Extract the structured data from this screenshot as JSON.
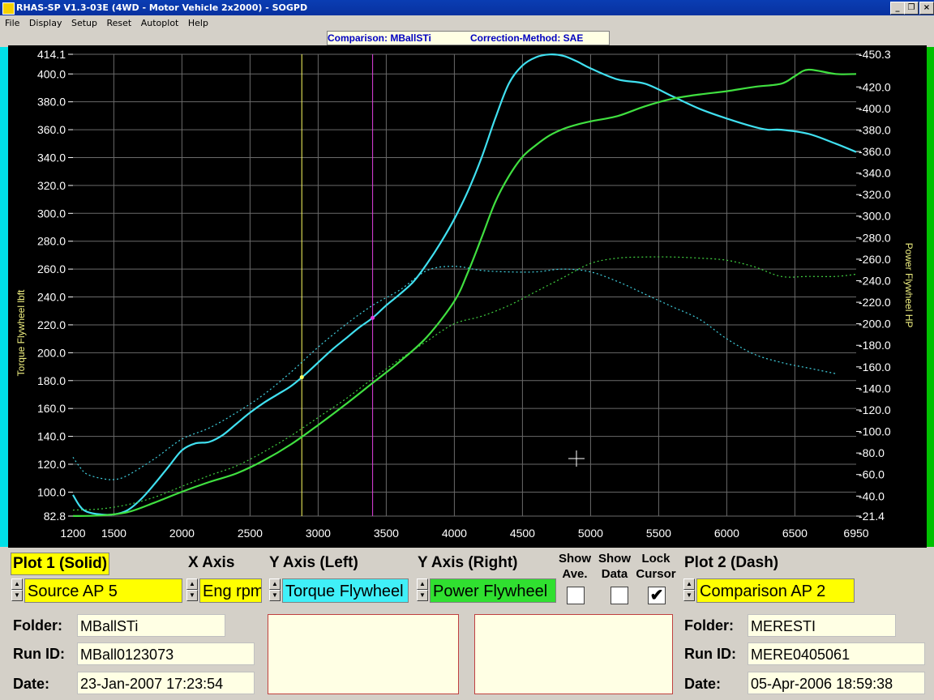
{
  "window": {
    "title": "RHAS-SP V1.3-03E  (4WD - Motor Vehicle 2x2000) - SOGPD",
    "minimize_glyph": "_",
    "restore_glyph": "❐",
    "close_glyph": "×"
  },
  "menu": [
    "File",
    "Display",
    "Setup",
    "Reset",
    "Autoplot",
    "Help"
  ],
  "status": {
    "comparison": "Comparison: MBallSTi",
    "correction": "Correction-Method: SAE"
  },
  "chart_data": {
    "type": "line",
    "xlim": [
      1200,
      6950
    ],
    "x_ticks": [
      "1200",
      "1500",
      "2000",
      "2500",
      "3000",
      "3500",
      "4000",
      "4500",
      "5000",
      "5500",
      "6000",
      "6500",
      "6950"
    ],
    "x_tick_values": [
      1200,
      1500,
      2000,
      2500,
      3000,
      3500,
      4000,
      4500,
      5000,
      5500,
      6000,
      6500,
      6950
    ],
    "ylim_left": [
      82.8,
      414.1
    ],
    "ylim_right": [
      21.4,
      450.3
    ],
    "y_left_ticks": [
      "82.8",
      "100.0",
      "120.0",
      "140.0",
      "160.0",
      "180.0",
      "200.0",
      "220.0",
      "240.0",
      "260.0",
      "280.0",
      "300.0",
      "320.0",
      "340.0",
      "360.0",
      "380.0",
      "400.0",
      "414.1"
    ],
    "y_left_tick_values": [
      82.8,
      100,
      120,
      140,
      160,
      180,
      200,
      220,
      240,
      260,
      280,
      300,
      320,
      340,
      360,
      380,
      400,
      414.1
    ],
    "y_right_ticks": [
      "21.4",
      "40.0",
      "60.0",
      "80.0",
      "100.0",
      "120.0",
      "140.0",
      "160.0",
      "180.0",
      "200.0",
      "220.0",
      "240.0",
      "260.0",
      "280.0",
      "300.0",
      "320.0",
      "340.0",
      "360.0",
      "380.0",
      "400.0",
      "420.0",
      "450.3"
    ],
    "y_right_tick_values": [
      21.4,
      40,
      60,
      80,
      100,
      120,
      140,
      160,
      180,
      200,
      220,
      240,
      260,
      280,
      300,
      320,
      340,
      360,
      380,
      400,
      420,
      450.3
    ],
    "ylabel_left": "Torque Flywheel lbft",
    "ylabel_right": "Power Flywheel HP",
    "grid": true,
    "cursors": [
      {
        "x": 2880,
        "color": "#ffff60"
      },
      {
        "x": 3400,
        "color": "#e040e0"
      }
    ],
    "series": [
      {
        "axis": "left",
        "style": "solid",
        "color": "#40e0f0",
        "x": [
          1200,
          1250,
          1300,
          1400,
          1500,
          1600,
          1700,
          1800,
          1900,
          2000,
          2100,
          2200,
          2300,
          2400,
          2500,
          2600,
          2700,
          2800,
          2900,
          3000,
          3100,
          3200,
          3300,
          3400,
          3500,
          3600,
          3700,
          3800,
          3900,
          4000,
          4100,
          4200,
          4300,
          4400,
          4500,
          4600,
          4700,
          4800,
          4900,
          5000,
          5200,
          5400,
          5600,
          5800,
          6000,
          6200,
          6300,
          6400,
          6600,
          6800,
          6950
        ],
        "y": [
          98,
          90,
          86,
          84,
          84,
          87,
          95,
          106,
          118,
          130,
          135,
          136,
          141,
          149,
          157,
          164,
          170,
          176,
          184,
          193,
          202,
          210,
          218,
          225,
          234,
          242,
          251,
          264,
          279,
          296,
          316,
          340,
          368,
          393,
          406,
          412,
          414,
          413,
          409,
          404,
          396,
          393,
          384,
          375,
          368,
          362,
          360,
          360,
          357,
          350,
          344
        ]
      },
      {
        "axis": "right",
        "style": "solid",
        "color": "#40e040",
        "x": [
          1200,
          1400,
          1600,
          1800,
          2000,
          2200,
          2400,
          2600,
          2800,
          3000,
          3200,
          3400,
          3600,
          3800,
          4000,
          4100,
          4200,
          4300,
          4400,
          4500,
          4600,
          4700,
          4800,
          4900,
          5000,
          5200,
          5400,
          5600,
          5800,
          6000,
          6200,
          6400,
          6500,
          6600,
          6800,
          6950
        ],
        "y": [
          21.5,
          22,
          25,
          34,
          44,
          53,
          61,
          73,
          88,
          106,
          125,
          145,
          165,
          188,
          221,
          248,
          280,
          313,
          337,
          355,
          366,
          375,
          381,
          385,
          388,
          393,
          402,
          409,
          413,
          416,
          420,
          423,
          430,
          436,
          432,
          432
        ]
      },
      {
        "axis": "left",
        "style": "dash",
        "color": "#40d0e0",
        "x": [
          1200,
          1250,
          1300,
          1400,
          1500,
          1600,
          1800,
          2000,
          2200,
          2400,
          2600,
          2800,
          3000,
          3200,
          3400,
          3600,
          3800,
          4000,
          4200,
          4400,
          4600,
          4800,
          5000,
          5200,
          5400,
          5600,
          5800,
          6000,
          6200,
          6400,
          6600,
          6800
        ],
        "y": [
          125,
          118,
          113,
          110,
          109,
          112,
          124,
          138,
          146,
          157,
          170,
          186,
          204,
          220,
          234,
          245,
          259,
          262,
          259,
          258,
          258,
          260,
          258,
          251,
          242,
          233,
          224,
          210,
          199,
          193,
          189,
          185
        ]
      },
      {
        "axis": "right",
        "style": "dash",
        "color": "#40d040",
        "x": [
          1200,
          1400,
          1600,
          1800,
          2000,
          2200,
          2400,
          2600,
          2800,
          3000,
          3200,
          3400,
          3600,
          3800,
          4000,
          4200,
          4400,
          4600,
          4800,
          5000,
          5200,
          5400,
          5600,
          5800,
          6000,
          6200,
          6400,
          6600,
          6800,
          6950
        ],
        "y": [
          27,
          28,
          32,
          39,
          49,
          59,
          68,
          81,
          96,
          113,
          130,
          149,
          167,
          184,
          200,
          207,
          217,
          230,
          243,
          256,
          261,
          262,
          262,
          261,
          259,
          253,
          244,
          244,
          244,
          246
        ]
      }
    ]
  },
  "controls": {
    "plot1_label": "Plot 1 (Solid)",
    "xaxis_label": "X Axis",
    "yaxis_left_label": "Y Axis (Left)",
    "yaxis_right_label": "Y Axis (Right)",
    "show_ave_label": "Show Ave.",
    "show_data_label": "Show Data",
    "lock_cursor_label": "Lock Cursor",
    "plot2_label": "Plot 2 (Dash)",
    "plot1_source": "Source AP 5",
    "xaxis_value": "Eng rpm",
    "yaxis_left_value": "Torque Flywheel",
    "yaxis_right_value": "Power Flywheel",
    "plot2_source": "Comparison AP 2",
    "lock_cursor_checked": "✔",
    "spin_up": "▲",
    "spin_down": "▼"
  },
  "colors": {
    "plot1_field": "#ffff00",
    "xaxis_field": "#ffff00",
    "yleft_field": "#40f0f8",
    "yright_field": "#30e030",
    "plot2_field": "#ffff00"
  },
  "info1": {
    "folder_label": "Folder:",
    "folder": "MBallSTi",
    "runid_label": "Run ID:",
    "runid": "MBall0123073",
    "date_label": "Date:",
    "date": "23-Jan-2007  17:23:54"
  },
  "info2": {
    "folder_label": "Folder:",
    "folder": "MERESTI",
    "runid_label": "Run ID:",
    "runid": "MERE0405061",
    "date_label": "Date:",
    "date": "05-Apr-2006  18:59:38"
  }
}
